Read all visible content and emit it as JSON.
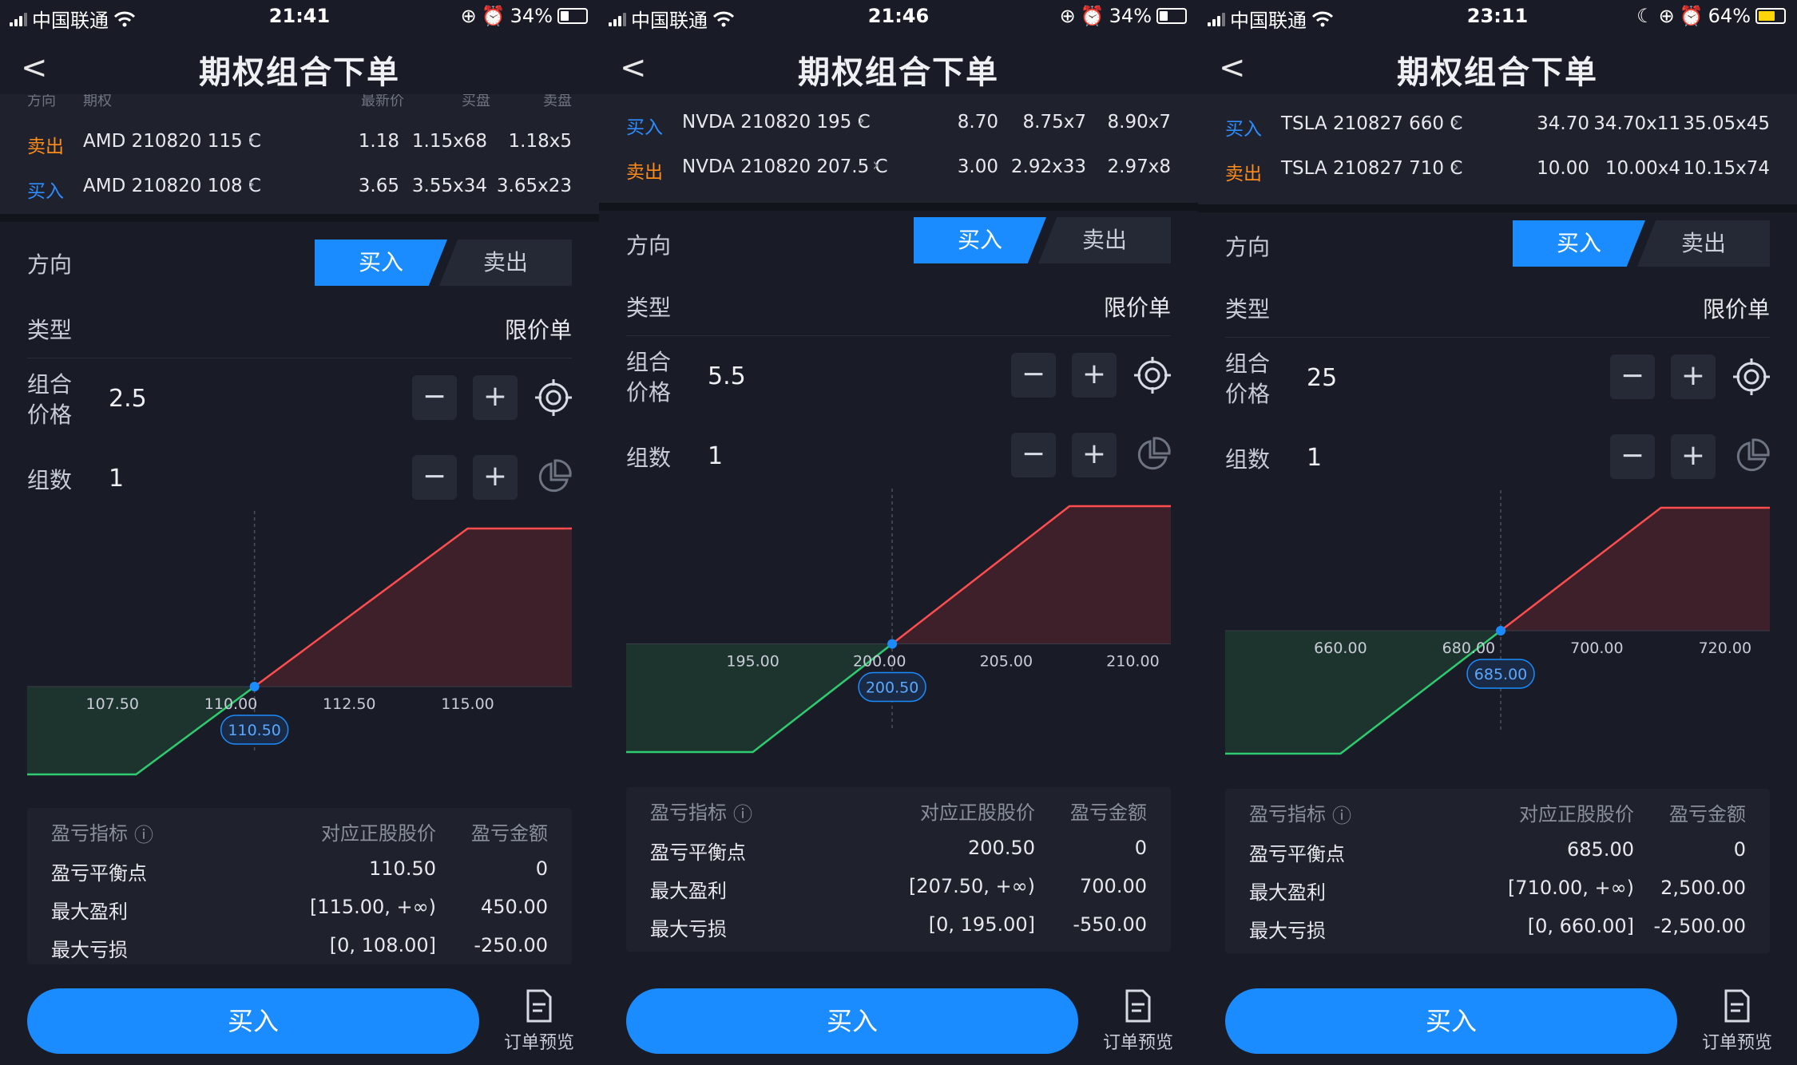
{
  "status_icons": {
    "signal": "signal-bars",
    "wifi": "wifi-icon",
    "lock": "rotation-lock-icon",
    "alarm": "alarm-icon",
    "moon": "do-not-disturb-icon",
    "battery": "battery-icon"
  },
  "colors": {
    "buy": "#2d8cff",
    "sell": "#ff8c1a",
    "accent": "#1a8cff",
    "profit": "#ff4d4f",
    "loss": "#2ecc71"
  },
  "panels": [
    {
      "status": {
        "carrier": "中国联通",
        "time": "21:41",
        "battery": "34%",
        "battery_level": 0.34,
        "dnd": false
      },
      "title": "期权组合下单",
      "legs_header": {
        "c1": "方向",
        "c2": "期权",
        "c3": "最新价",
        "c4": "买盘",
        "c5": "卖盘"
      },
      "legs": [
        {
          "side": "卖出",
          "side_type": "sell",
          "name": "AMD 210820 115 C",
          "last": "1.18",
          "bid": "1.15x68",
          "ask": "1.18x5"
        },
        {
          "side": "买入",
          "side_type": "buy",
          "name": "AMD 210820 108 C",
          "last": "3.65",
          "bid": "3.55x34",
          "ask": "3.65x23"
        }
      ],
      "direction_label": "方向",
      "buy_label": "买入",
      "sell_label": "卖出",
      "type_label": "类型",
      "type_value": "限价单",
      "price_label_1": "组合",
      "price_label_2": "价格",
      "price_value": "2.5",
      "qty_label": "组数",
      "qty_value": "1",
      "minus": "−",
      "plus": "+",
      "chart_data": {
        "type": "line",
        "x_ticks": [
          "107.50",
          "110.00",
          "112.50",
          "115.00"
        ],
        "x_tick_values": [
          107.5,
          110.0,
          112.5,
          115.0
        ],
        "xlim": [
          105.7,
          117.2
        ],
        "breakeven": "110.50",
        "breakeven_value": 110.5,
        "points": [
          [
            105.7,
            -250
          ],
          [
            108.0,
            -250
          ],
          [
            115.0,
            450
          ],
          [
            117.2,
            450
          ]
        ],
        "ylim": [
          -250,
          450
        ]
      },
      "metrics": {
        "h1": "盈亏指标",
        "h2": "对应正股股价",
        "h3": "盈亏金额",
        "rows": [
          {
            "label": "盈亏平衡点",
            "price": "110.50",
            "amount": "0"
          },
          {
            "label": "最大盈利",
            "price": "[115.00, +∞)",
            "amount": "450.00"
          },
          {
            "label": "最大亏损",
            "price": "[0, 108.00]",
            "amount": "-250.00"
          }
        ]
      },
      "main_button": "买入",
      "preview_label": "订单预览"
    },
    {
      "status": {
        "carrier": "中国联通",
        "time": "21:46",
        "battery": "34%",
        "battery_level": 0.34,
        "dnd": false
      },
      "title": "期权组合下单",
      "legs": [
        {
          "side": "买入",
          "side_type": "buy",
          "name": "NVDA 210820 195 C",
          "last": "8.70",
          "bid": "8.75x7",
          "ask": "8.90x7"
        },
        {
          "side": "卖出",
          "side_type": "sell",
          "name": "NVDA 210820 207.5 C",
          "last": "3.00",
          "bid": "2.92x33",
          "ask": "2.97x8"
        }
      ],
      "direction_label": "方向",
      "buy_label": "买入",
      "sell_label": "卖出",
      "type_label": "类型",
      "type_value": "限价单",
      "price_label_1": "组合",
      "price_label_2": "价格",
      "price_value": "5.5",
      "qty_label": "组数",
      "qty_value": "1",
      "minus": "−",
      "plus": "+",
      "chart_data": {
        "type": "line",
        "x_ticks": [
          "195.00",
          "200.00",
          "205.00",
          "210.00"
        ],
        "x_tick_values": [
          195.0,
          200.0,
          205.0,
          210.0
        ],
        "xlim": [
          190.0,
          211.5
        ],
        "breakeven": "200.50",
        "breakeven_value": 200.5,
        "points": [
          [
            190.0,
            -550
          ],
          [
            195.0,
            -550
          ],
          [
            207.5,
            700
          ],
          [
            211.5,
            700
          ]
        ],
        "ylim": [
          -550,
          700
        ]
      },
      "metrics": {
        "h1": "盈亏指标",
        "h2": "对应正股股价",
        "h3": "盈亏金额",
        "rows": [
          {
            "label": "盈亏平衡点",
            "price": "200.50",
            "amount": "0"
          },
          {
            "label": "最大盈利",
            "price": "[207.50, +∞)",
            "amount": "700.00"
          },
          {
            "label": "最大亏损",
            "price": "[0, 195.00]",
            "amount": "-550.00"
          }
        ]
      },
      "main_button": "买入",
      "preview_label": "订单预览"
    },
    {
      "status": {
        "carrier": "中国联通",
        "time": "23:11",
        "battery": "64%",
        "battery_level": 0.64,
        "dnd": true
      },
      "title": "期权组合下单",
      "legs": [
        {
          "side": "买入",
          "side_type": "buy",
          "name": "TSLA 210827 660 C",
          "last": "34.70",
          "bid": "34.70x11",
          "ask": "35.05x45"
        },
        {
          "side": "卖出",
          "side_type": "sell",
          "name": "TSLA 210827 710 C",
          "last": "10.00",
          "bid": "10.00x4",
          "ask": "10.15x74"
        }
      ],
      "direction_label": "方向",
      "buy_label": "买入",
      "sell_label": "卖出",
      "type_label": "类型",
      "type_value": "限价单",
      "price_label_1": "组合",
      "price_label_2": "价格",
      "price_value": "25",
      "qty_label": "组数",
      "qty_value": "1",
      "minus": "−",
      "plus": "+",
      "chart_data": {
        "type": "line",
        "x_ticks": [
          "660.00",
          "680.00",
          "700.00",
          "720.00"
        ],
        "x_tick_values": [
          660.0,
          680.0,
          700.0,
          720.0
        ],
        "xlim": [
          642.0,
          727.0
        ],
        "breakeven": "685.00",
        "breakeven_value": 685.0,
        "points": [
          [
            642.0,
            -2500
          ],
          [
            660.0,
            -2500
          ],
          [
            710.0,
            2500
          ],
          [
            727.0,
            2500
          ]
        ],
        "ylim": [
          -2500,
          2500
        ]
      },
      "metrics": {
        "h1": "盈亏指标",
        "h2": "对应正股股价",
        "h3": "盈亏金额",
        "rows": [
          {
            "label": "盈亏平衡点",
            "price": "685.00",
            "amount": "0"
          },
          {
            "label": "最大盈利",
            "price": "[710.00, +∞)",
            "amount": "2,500.00"
          },
          {
            "label": "最大亏损",
            "price": "[0, 660.00]",
            "amount": "-2,500.00"
          }
        ]
      },
      "main_button": "买入",
      "preview_label": "订单预览"
    }
  ]
}
